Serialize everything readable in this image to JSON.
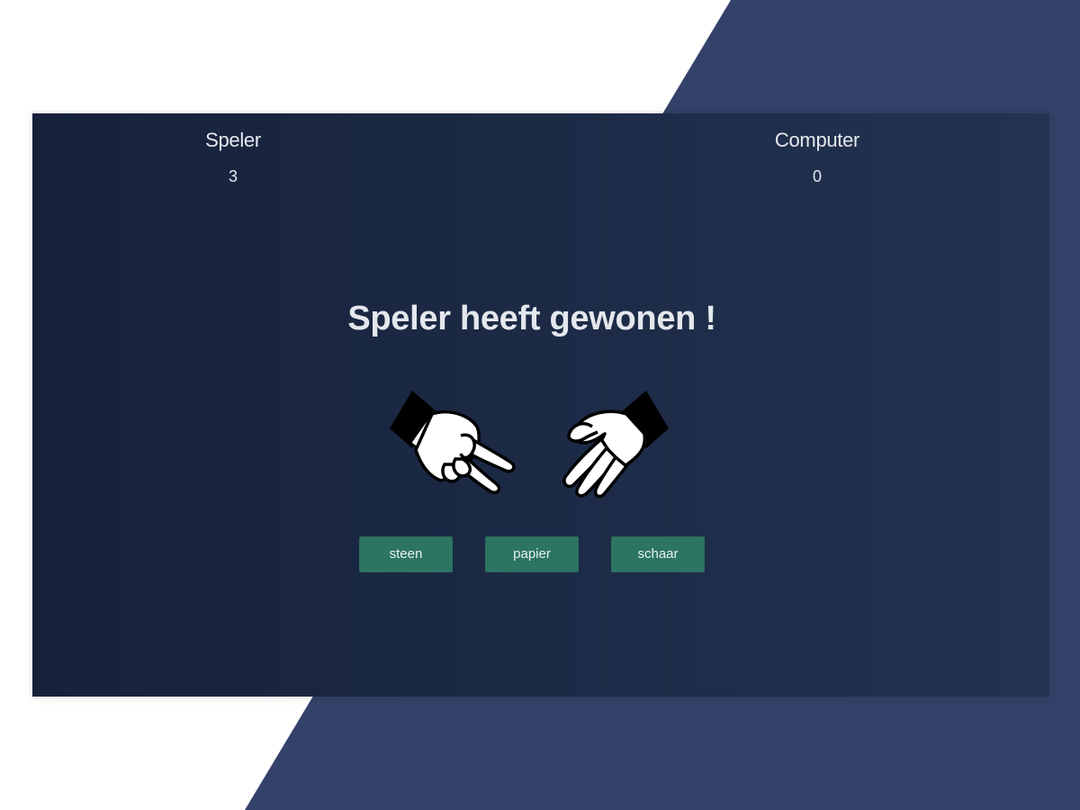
{
  "colors": {
    "backdrop_band": "#344168",
    "panel_start": "#17213a",
    "panel_end": "#223350",
    "button": "#2c7562",
    "text": "#e4e7ec"
  },
  "scoreboard": {
    "player": {
      "label": "Speler",
      "score": "3"
    },
    "computer": {
      "label": "Computer",
      "score": "0"
    }
  },
  "result": {
    "message": "Speler heeft gewonen !"
  },
  "hands": {
    "player_choice_icon": "scissors-hand-icon",
    "computer_choice_icon": "paper-hand-icon"
  },
  "choices": [
    {
      "label": "steen"
    },
    {
      "label": "papier"
    },
    {
      "label": "schaar"
    }
  ]
}
